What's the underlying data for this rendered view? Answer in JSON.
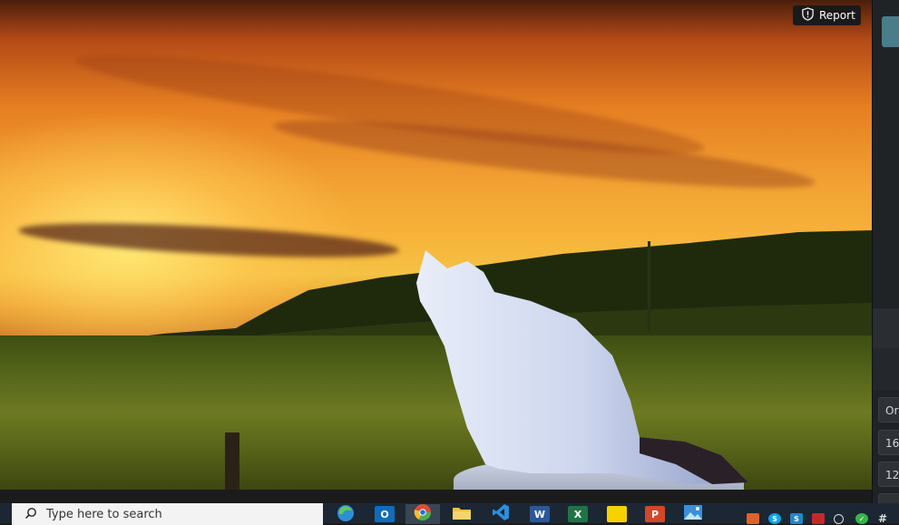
{
  "wallpaper": {
    "report_label": "Report",
    "report_icon": "shield-icon"
  },
  "side_panel": {
    "buttons": [
      "Or",
      "16",
      "12"
    ]
  },
  "taskbar": {
    "search_placeholder": "Type here to search",
    "apps": [
      {
        "name": "edge",
        "icon": "edge-icon",
        "color": "#2d8fd5"
      },
      {
        "name": "outlook",
        "icon": "outlook-icon",
        "color": "#0f6cbd",
        "glyph": "O"
      },
      {
        "name": "chrome",
        "icon": "chrome-icon",
        "color": "#dd4b39"
      },
      {
        "name": "file-explorer",
        "icon": "folder-icon",
        "color": "#f2c144"
      },
      {
        "name": "vscode",
        "icon": "vscode-icon",
        "color": "#2a8fe0"
      },
      {
        "name": "word",
        "icon": "word-icon",
        "color": "#2b579a",
        "glyph": "W"
      },
      {
        "name": "excel",
        "icon": "excel-icon",
        "color": "#217346",
        "glyph": "X"
      },
      {
        "name": "sticky-notes",
        "icon": "sticky-notes-icon",
        "color": "#f7d200"
      },
      {
        "name": "powerpoint",
        "icon": "powerpoint-icon",
        "color": "#d24726",
        "glyph": "P"
      },
      {
        "name": "photos",
        "icon": "photos-icon",
        "color": "#3b8ed8"
      }
    ],
    "tray": [
      {
        "icon": "tray-app-1-icon",
        "color": "#e0622a"
      },
      {
        "icon": "tray-skype-icon",
        "color": "#00a8e8"
      },
      {
        "icon": "tray-app-3-icon",
        "color": "#1e88c7"
      },
      {
        "icon": "tray-app-4-icon",
        "color": "#c22a2a"
      },
      {
        "icon": "tray-search-icon",
        "color": "#444"
      },
      {
        "icon": "tray-check-icon",
        "color": "#39b54a"
      },
      {
        "icon": "tray-slack-icon",
        "color": "#611f69"
      }
    ]
  }
}
